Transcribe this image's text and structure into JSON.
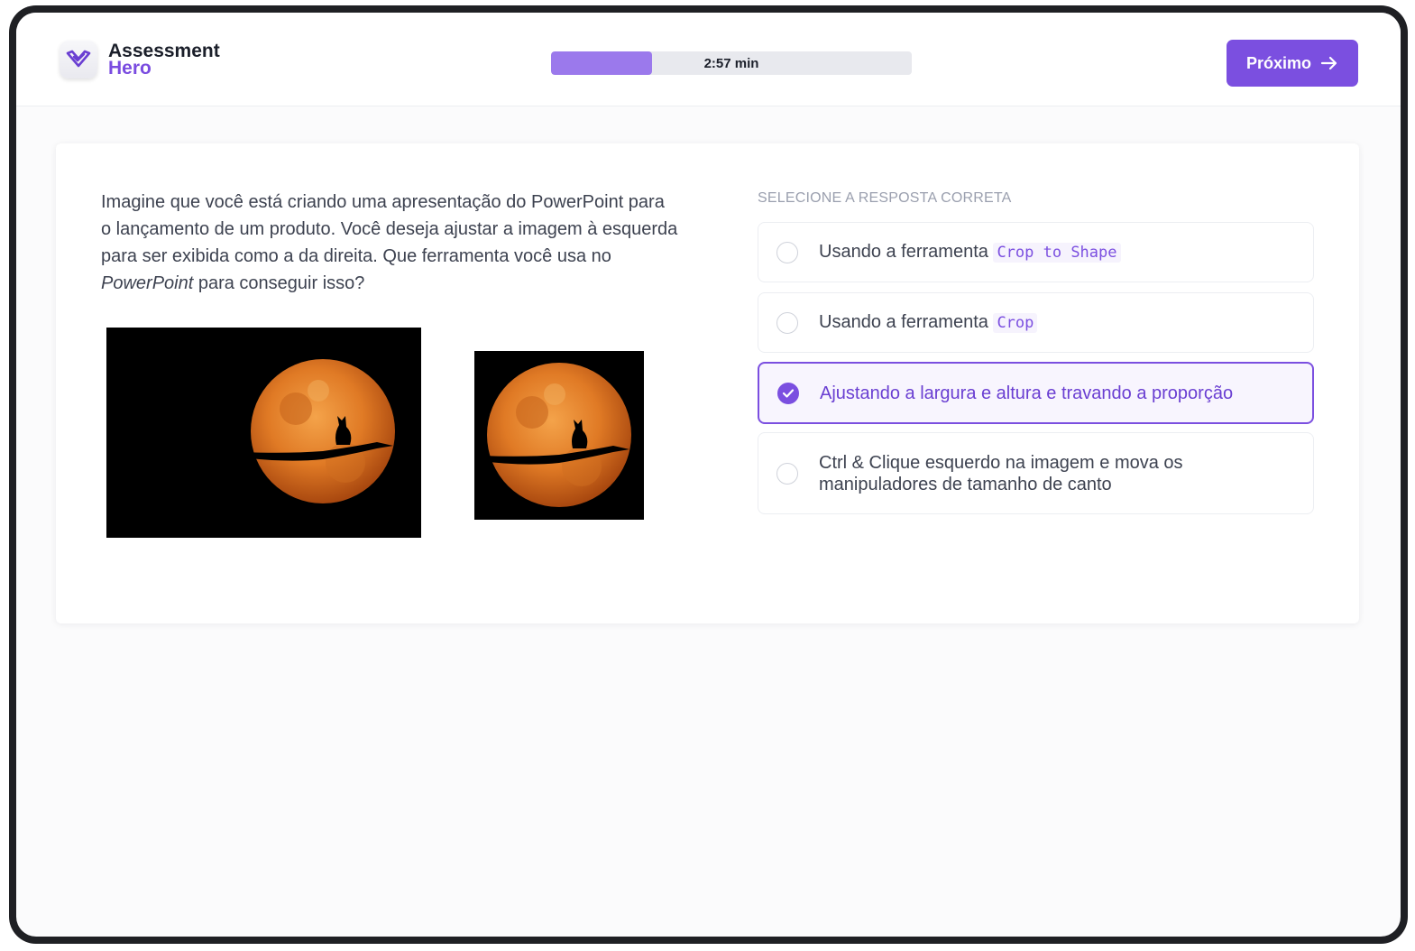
{
  "brand": {
    "name_line1": "Assessment",
    "name_line2": "Hero",
    "accent_color": "#7b4fe0",
    "icon": "check-heart-logo-icon"
  },
  "timer": {
    "label": "2:57 min",
    "progress_fraction": 0.28
  },
  "header": {
    "next_button_label": "Próximo",
    "next_button_icon": "arrow-right-icon"
  },
  "question": {
    "text_before_italic": "Imagine que você está criando uma apresentação do PowerPoint para o lançamento de um produto. Você deseja ajustar a imagem à esquerda para ser exibida como a da direita. Que ferramenta você usa no ",
    "text_italic": "PowerPoint",
    "text_after_italic": " para conseguir isso?"
  },
  "answers": {
    "label": "SELECIONE A RESPOSTA CORRETA",
    "options": [
      {
        "text": "Usando a ferramenta ",
        "code": "Crop to Shape",
        "selected": false
      },
      {
        "text": "Usando a ferramenta ",
        "code": "Crop",
        "selected": false
      },
      {
        "text": "Ajustando a largura e altura e travando a proporção",
        "code": "",
        "selected": true
      },
      {
        "text": "Ctrl & Clique esquerdo na imagem e mova os manipuladores de tamanho de canto",
        "code": "",
        "selected": false
      }
    ]
  }
}
